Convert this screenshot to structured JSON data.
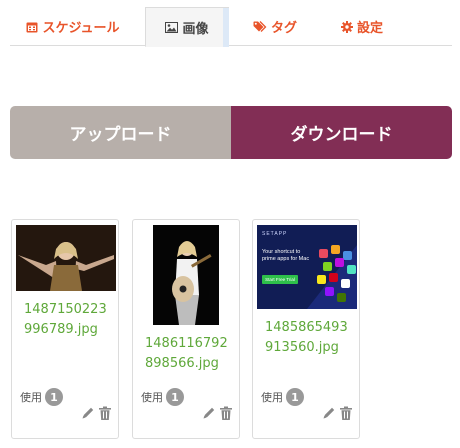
{
  "tabs": [
    {
      "label": "スケジュール",
      "icon": "calendar-icon"
    },
    {
      "label": "画像",
      "icon": "image-icon"
    },
    {
      "label": "タグ",
      "icon": "tags-icon"
    },
    {
      "label": "設定",
      "icon": "gear-icon"
    }
  ],
  "active_tab": "画像",
  "buttons": {
    "upload": "アップロード",
    "download": "ダウンロード"
  },
  "colors": {
    "accent": "#e8542a",
    "upload_bg": "#b7afaa",
    "download_bg": "#822e55",
    "filename": "#5fa83a"
  },
  "images": [
    {
      "filename": "1487150223996789.jpg",
      "usage_label": "使用",
      "usage_count": "1"
    },
    {
      "filename": "1486116792898566.jpg",
      "usage_label": "使用",
      "usage_count": "1"
    },
    {
      "filename": "1485865493913560.jpg",
      "usage_label": "使用",
      "usage_count": "1"
    }
  ],
  "ad": {
    "brand": "SETAPP",
    "headline": "Your shortcut to prime apps for Mac",
    "cta": "Start Free Trial"
  }
}
